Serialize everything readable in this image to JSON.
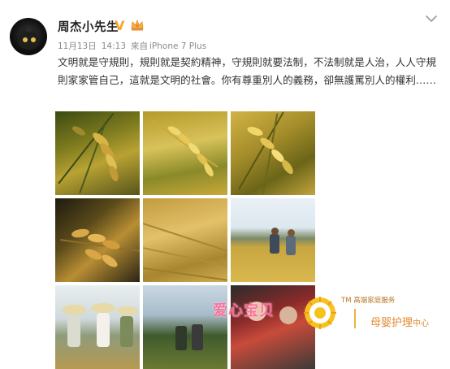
{
  "post": {
    "username": "周杰小先生",
    "verified_badge": "V",
    "date": "11月13日",
    "time": "14:13",
    "source_prefix": "來自",
    "device": "iPhone 7 Plus",
    "text": "文明就是守規則，規則就是契約精神，守規則就要法制，不法制就是人治，人人守規則家家管自己，這就是文明的社會。你有尊重別人的義務，卻無護罵別人的權利……"
  },
  "images": [
    {
      "subject": "rice-ear-closeup"
    },
    {
      "subject": "golden-rice-panicle"
    },
    {
      "subject": "rice-stalks-sunlight"
    },
    {
      "subject": "rice-grains-dark"
    },
    {
      "subject": "rice-field-golden"
    },
    {
      "subject": "farmers-in-field"
    },
    {
      "subject": "farmers-with-straw-hats"
    },
    {
      "subject": "field-with-trees"
    },
    {
      "subject": "crowd-red"
    }
  ],
  "watermark": {
    "left_text": "爱心宝贝",
    "tm_label": "TM 高端家庭服务",
    "right_text": "母婴护理",
    "right_small": "中心"
  },
  "colors": {
    "username": "#222222",
    "meta": "#8a8a8a",
    "verified_badge": "#f5a623",
    "watermark_pink": "#ff6996",
    "watermark_orange": "#e28a2e"
  },
  "icons": {
    "expand": "chevron-down-icon",
    "verified": "verified-badge-icon",
    "member": "crown-icon"
  }
}
